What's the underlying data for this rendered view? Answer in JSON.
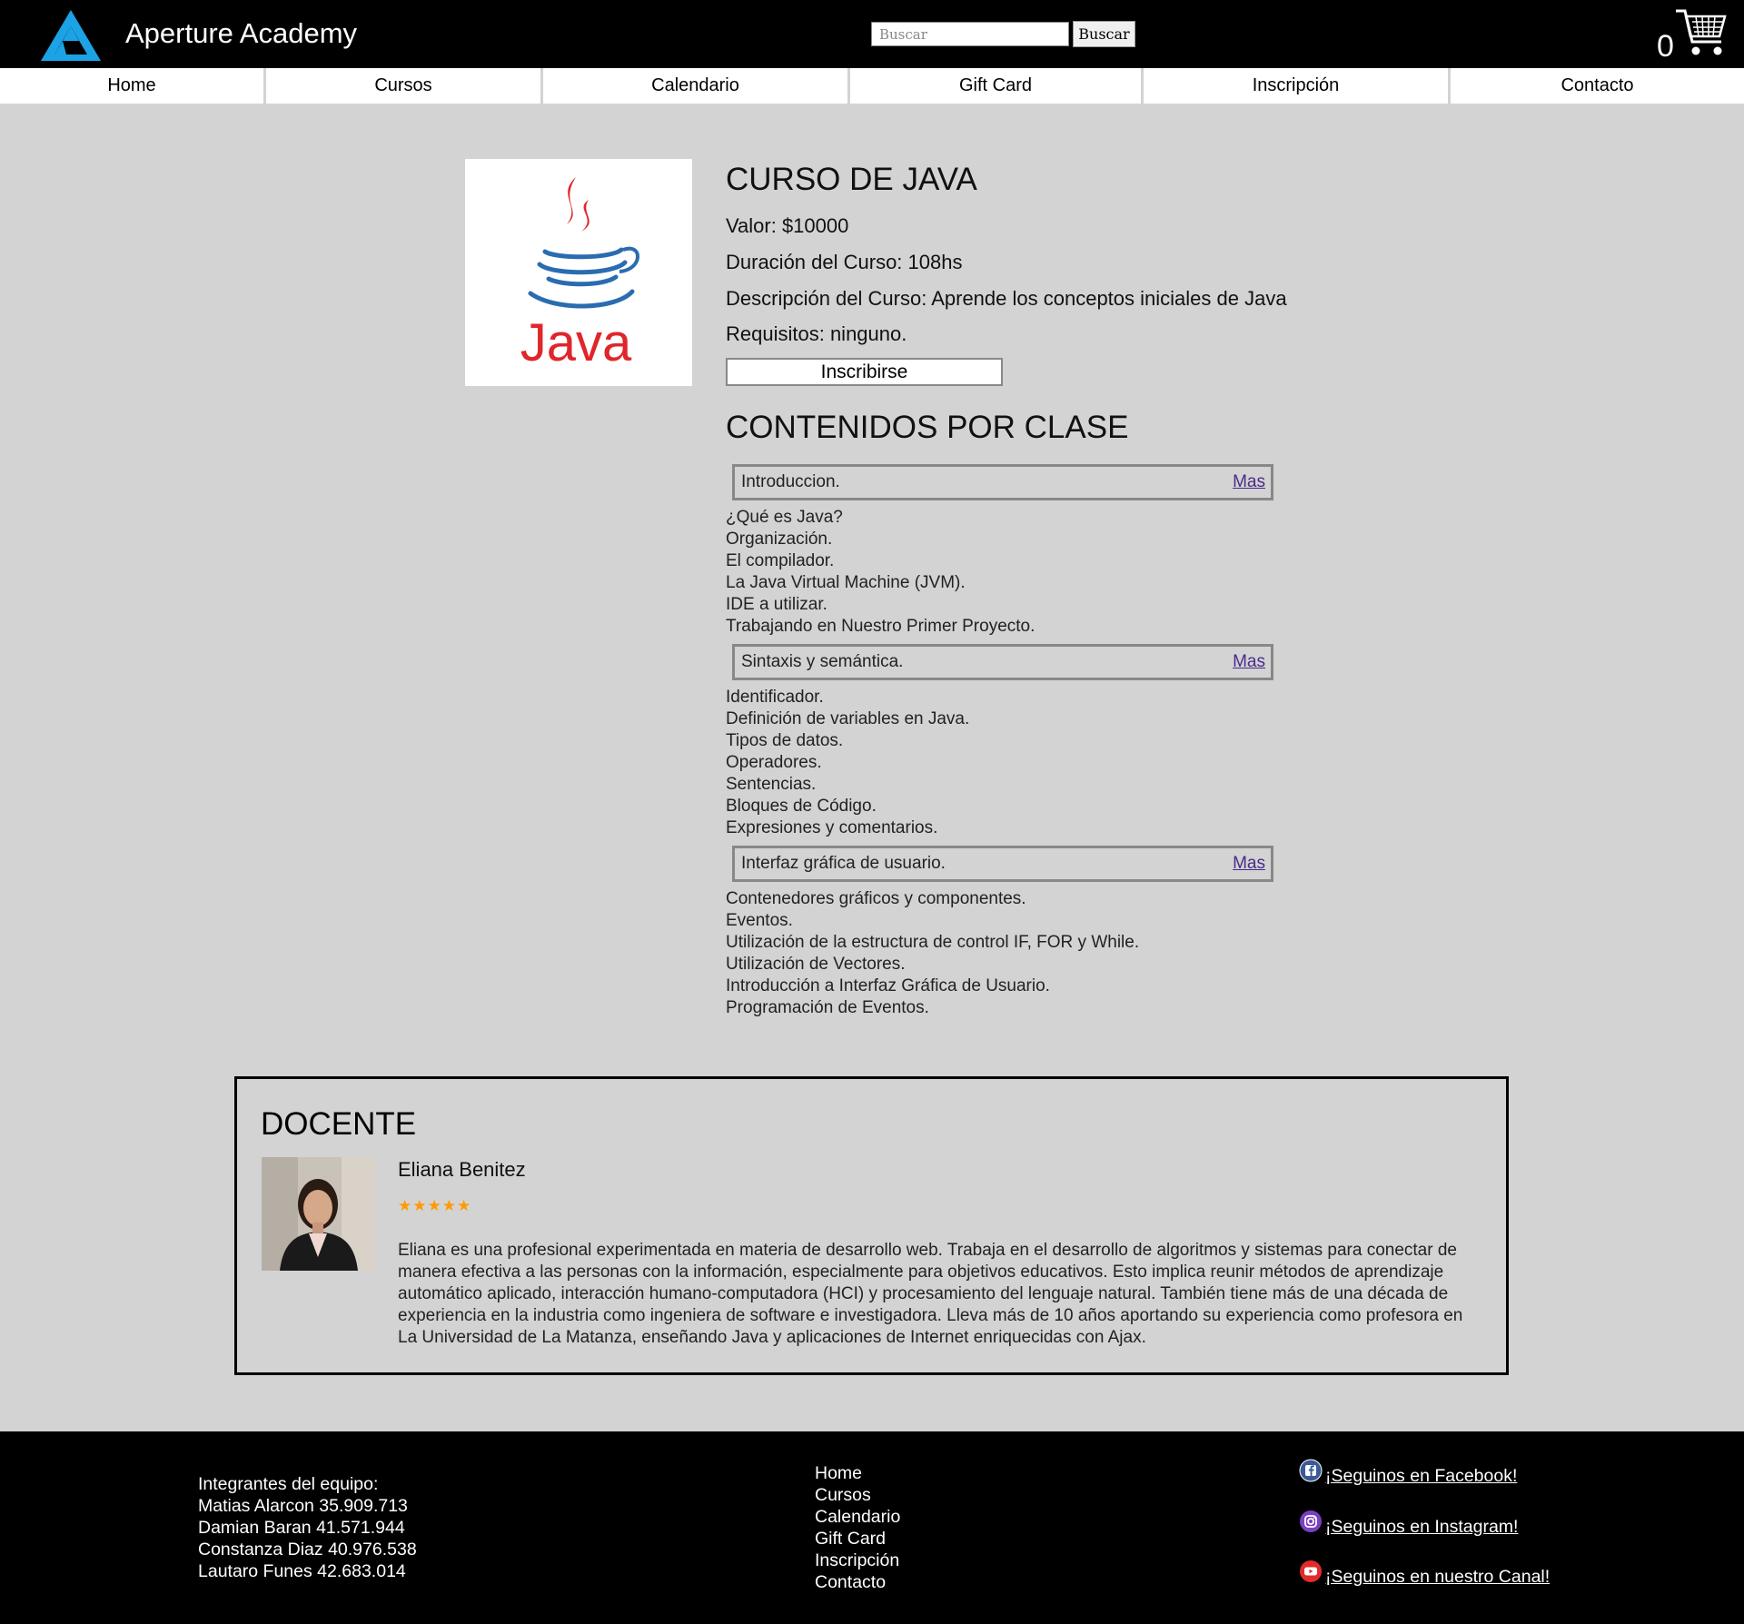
{
  "header": {
    "brand": "Aperture Academy",
    "search_placeholder": "Buscar",
    "search_button": "Buscar",
    "cart_count": "0"
  },
  "nav": {
    "items": [
      "Home",
      "Cursos",
      "Calendario",
      "Gift Card",
      "Inscripción",
      "Contacto"
    ]
  },
  "course": {
    "title": "CURSO DE JAVA",
    "value": "Valor: $10000",
    "duration": "Duración del Curso: 108hs",
    "description": "Descripción del Curso: Aprende los conceptos iniciales de Java",
    "requirements": "Requisitos: ninguno.",
    "enroll_button": "Inscribirse",
    "image_text": "Java"
  },
  "contents": {
    "title": "CONTENIDOS POR CLASE",
    "more_label": "Mas",
    "classes": [
      {
        "name": "Introduccion.",
        "topics": [
          "¿Qué es Java?",
          "Organización.",
          "El compilador.",
          "La Java Virtual Machine (JVM).",
          "IDE a utilizar.",
          "Trabajando en Nuestro Primer Proyecto."
        ]
      },
      {
        "name": "Sintaxis y semántica.",
        "topics": [
          "Identificador.",
          "Definición de variables en Java.",
          "Tipos de datos.",
          "Operadores.",
          "Sentencias.",
          "Bloques de Código.",
          "Expresiones y comentarios."
        ]
      },
      {
        "name": "Interfaz gráfica de usuario.",
        "topics": [
          "Contenedores gráficos y componentes.",
          "Eventos.",
          "Utilización de la estructura de control IF, FOR y While.",
          "Utilización de Vectores.",
          "Introducción a Interfaz Gráfica de Usuario.",
          "Programación de Eventos."
        ]
      }
    ]
  },
  "teacher": {
    "heading": "DOCENTE",
    "name": "Eliana Benitez",
    "stars": "★★★★★",
    "rating": 5,
    "bio": "Eliana es una profesional experimentada en materia de desarrollo web. Trabaja en el desarrollo de algoritmos y sistemas para conectar de manera efectiva a las personas con la información, especialmente para objetivos educativos. Esto implica reunir métodos de aprendizaje automático aplicado, interacción humano-computadora (HCI) y procesamiento del lenguaje natural. También tiene más de una década de experiencia en la industria como ingeniera de software e investigadora. Lleva más de 10 años aportando su experiencia como profesora en La Universidad de La Matanza, enseñando Java y aplicaciones de Internet enriquecidas con Ajax."
  },
  "footer": {
    "team": [
      "Integrantes del equipo:",
      "Matias Alarcon 35.909.713",
      "Damian Baran 41.571.944",
      "Constanza Diaz 40.976.538",
      "Lautaro Funes 42.683.014"
    ],
    "links": [
      "Home",
      "Cursos",
      "Calendario",
      "Gift Card",
      "Inscripción",
      "Contacto"
    ],
    "social": {
      "facebook": "¡Seguinos en Facebook!",
      "instagram": "¡Seguinos en Instagram!",
      "youtube": "¡Seguinos en nuestro Canal!"
    }
  },
  "colors": {
    "header_bg": "#000000",
    "page_bg": "#d3d3d3",
    "logo_blue": "#1ba3e6",
    "stars": "#ff9a00",
    "link": "#4b2a8a",
    "java_red": "#e0262b",
    "java_blue": "#2a6cb0"
  },
  "icons": [
    "aperture-logo-icon",
    "cart-icon",
    "java-logo-icon",
    "facebook-icon",
    "instagram-icon",
    "youtube-icon"
  ]
}
